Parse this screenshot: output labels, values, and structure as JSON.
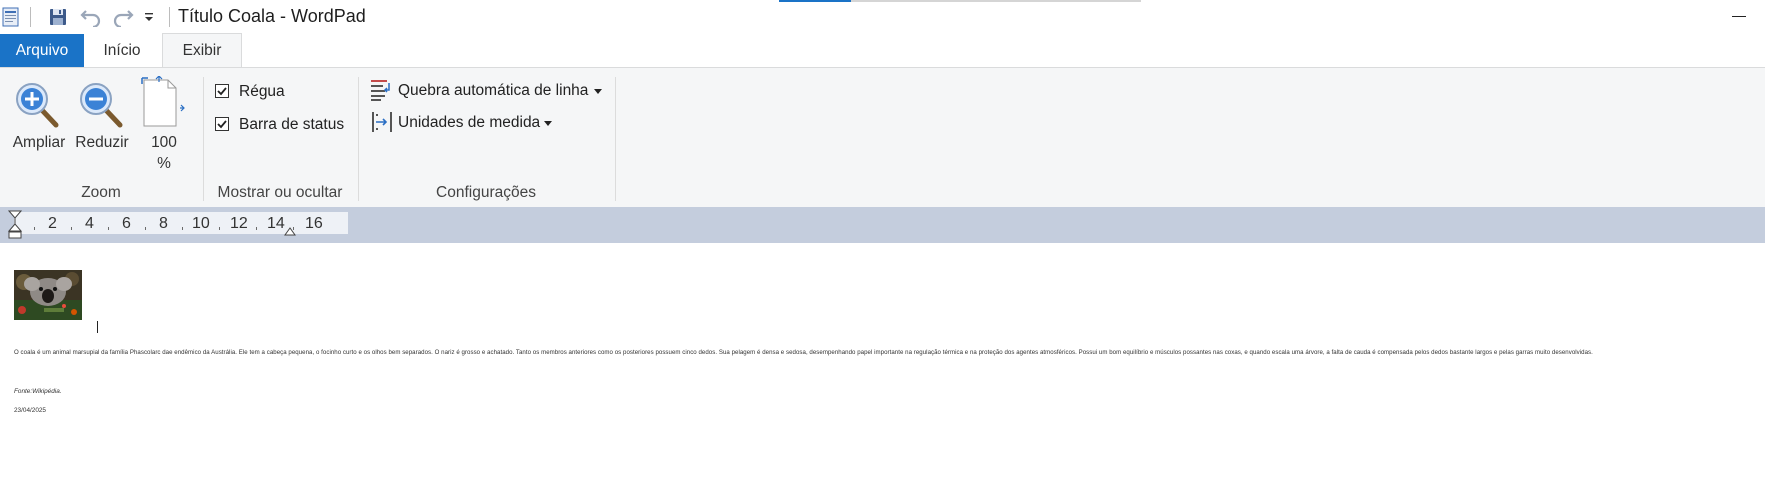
{
  "window": {
    "title": "Título Coala - WordPad"
  },
  "quick_access": {
    "icons": [
      "app-icon",
      "save-icon",
      "undo-icon",
      "redo-icon",
      "customize-quick-access-icon"
    ]
  },
  "tabs": [
    {
      "label": "Arquivo"
    },
    {
      "label": "Início"
    },
    {
      "label": "Exibir"
    }
  ],
  "ribbon": {
    "zoom": {
      "group_label": "Zoom",
      "zoom_in_label": "Ampliar",
      "zoom_out_label": "Reduzir",
      "zoom_100_line1": "100",
      "zoom_100_line2": "%"
    },
    "show_hide": {
      "group_label": "Mostrar ou ocultar",
      "ruler_label": "Régua",
      "ruler_checked": true,
      "statusbar_label": "Barra de status",
      "statusbar_checked": true
    },
    "settings": {
      "group_label": "Configurações",
      "word_wrap_label": "Quebra automática de linha",
      "units_label": "Unidades de medida"
    }
  },
  "ruler": {
    "ticks": [
      "2",
      "4",
      "6",
      "8",
      "10",
      "12",
      "14",
      "16"
    ]
  },
  "document": {
    "paragraph": "O coala é um animal marsupial da família Phascolarc dae endêmico da Austrália.  Ele tem a cabeça pequena,  o focinho curto e os olhos bem separados.  O nariz é grosso e achatado.  Tanto  os membros anteriores  como os posteriores  possuem cinco dedos. Sua pelagem  é densa e sedosa, desempenhando  papel  importante  na regulação  térmica  e na proteção  dos agentes  atmosféricos.  Possui um bom equilíbrio e músculos possantes nas coxas, e quando escala uma árvore,  a falta  de cauda é compensada  pelos dedos bastante  largos e pelas garras  muito desenvolvidas.",
    "source": "Fonte:Wikipédia.",
    "date": "23/04/2025"
  },
  "colors": {
    "accent": "#1a73c7",
    "ribbon_bg": "#f5f6f7",
    "ruler_bg": "#c4cddd"
  }
}
